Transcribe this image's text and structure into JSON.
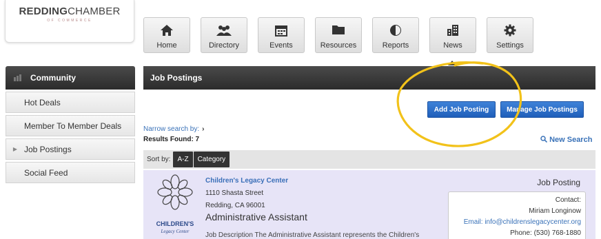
{
  "logo": {
    "main_bold": "REDDING",
    "main_thin": "CHAMBER",
    "sub": "OF COMMERCE"
  },
  "nav": [
    {
      "label": "Home",
      "icon": "home-icon"
    },
    {
      "label": "Directory",
      "icon": "people-icon"
    },
    {
      "label": "Events",
      "icon": "calendar-icon"
    },
    {
      "label": "Resources",
      "icon": "folder-icon"
    },
    {
      "label": "Reports",
      "icon": "pie-chart-icon"
    },
    {
      "label": "News",
      "icon": "building-icon"
    },
    {
      "label": "Settings",
      "icon": "gear-icon"
    }
  ],
  "sidebar": {
    "header": "Community",
    "items": [
      {
        "label": "Hot Deals"
      },
      {
        "label": "Member To Member Deals"
      },
      {
        "label": "Job Postings"
      },
      {
        "label": "Social Feed"
      }
    ]
  },
  "main": {
    "title": "Job Postings",
    "add_button": "Add Job Posting",
    "manage_button": "Manage Job Postings",
    "narrow_label": "Narrow search by:",
    "narrow_chevron": "›",
    "results": "Results Found: 7",
    "new_search": "New Search",
    "sort_label": "Sort by:",
    "sort_az": "A-Z",
    "sort_category": "Category"
  },
  "listing": {
    "org_name": "Children's Legacy Center",
    "address_line1": "1110 Shasta Street",
    "address_line2": "Redding, CA 96001",
    "job_title": "Administrative Assistant",
    "type": "Job Posting",
    "description": "Job Description The Administrative Assistant represents the Children's",
    "logo_text_main": "CHILDREN'S",
    "logo_text_sub": "Legacy Center",
    "contact": {
      "label": "Contact:",
      "name": "Miriam Longinow",
      "email": "Email: info@childrenslegacycenter.org",
      "phone": "Phone: (530) 768-1880"
    }
  },
  "colors": {
    "accent_blue": "#2a6fcc",
    "highlight_yellow": "#f2c21a",
    "listing_bg": "#e7e4f7"
  }
}
